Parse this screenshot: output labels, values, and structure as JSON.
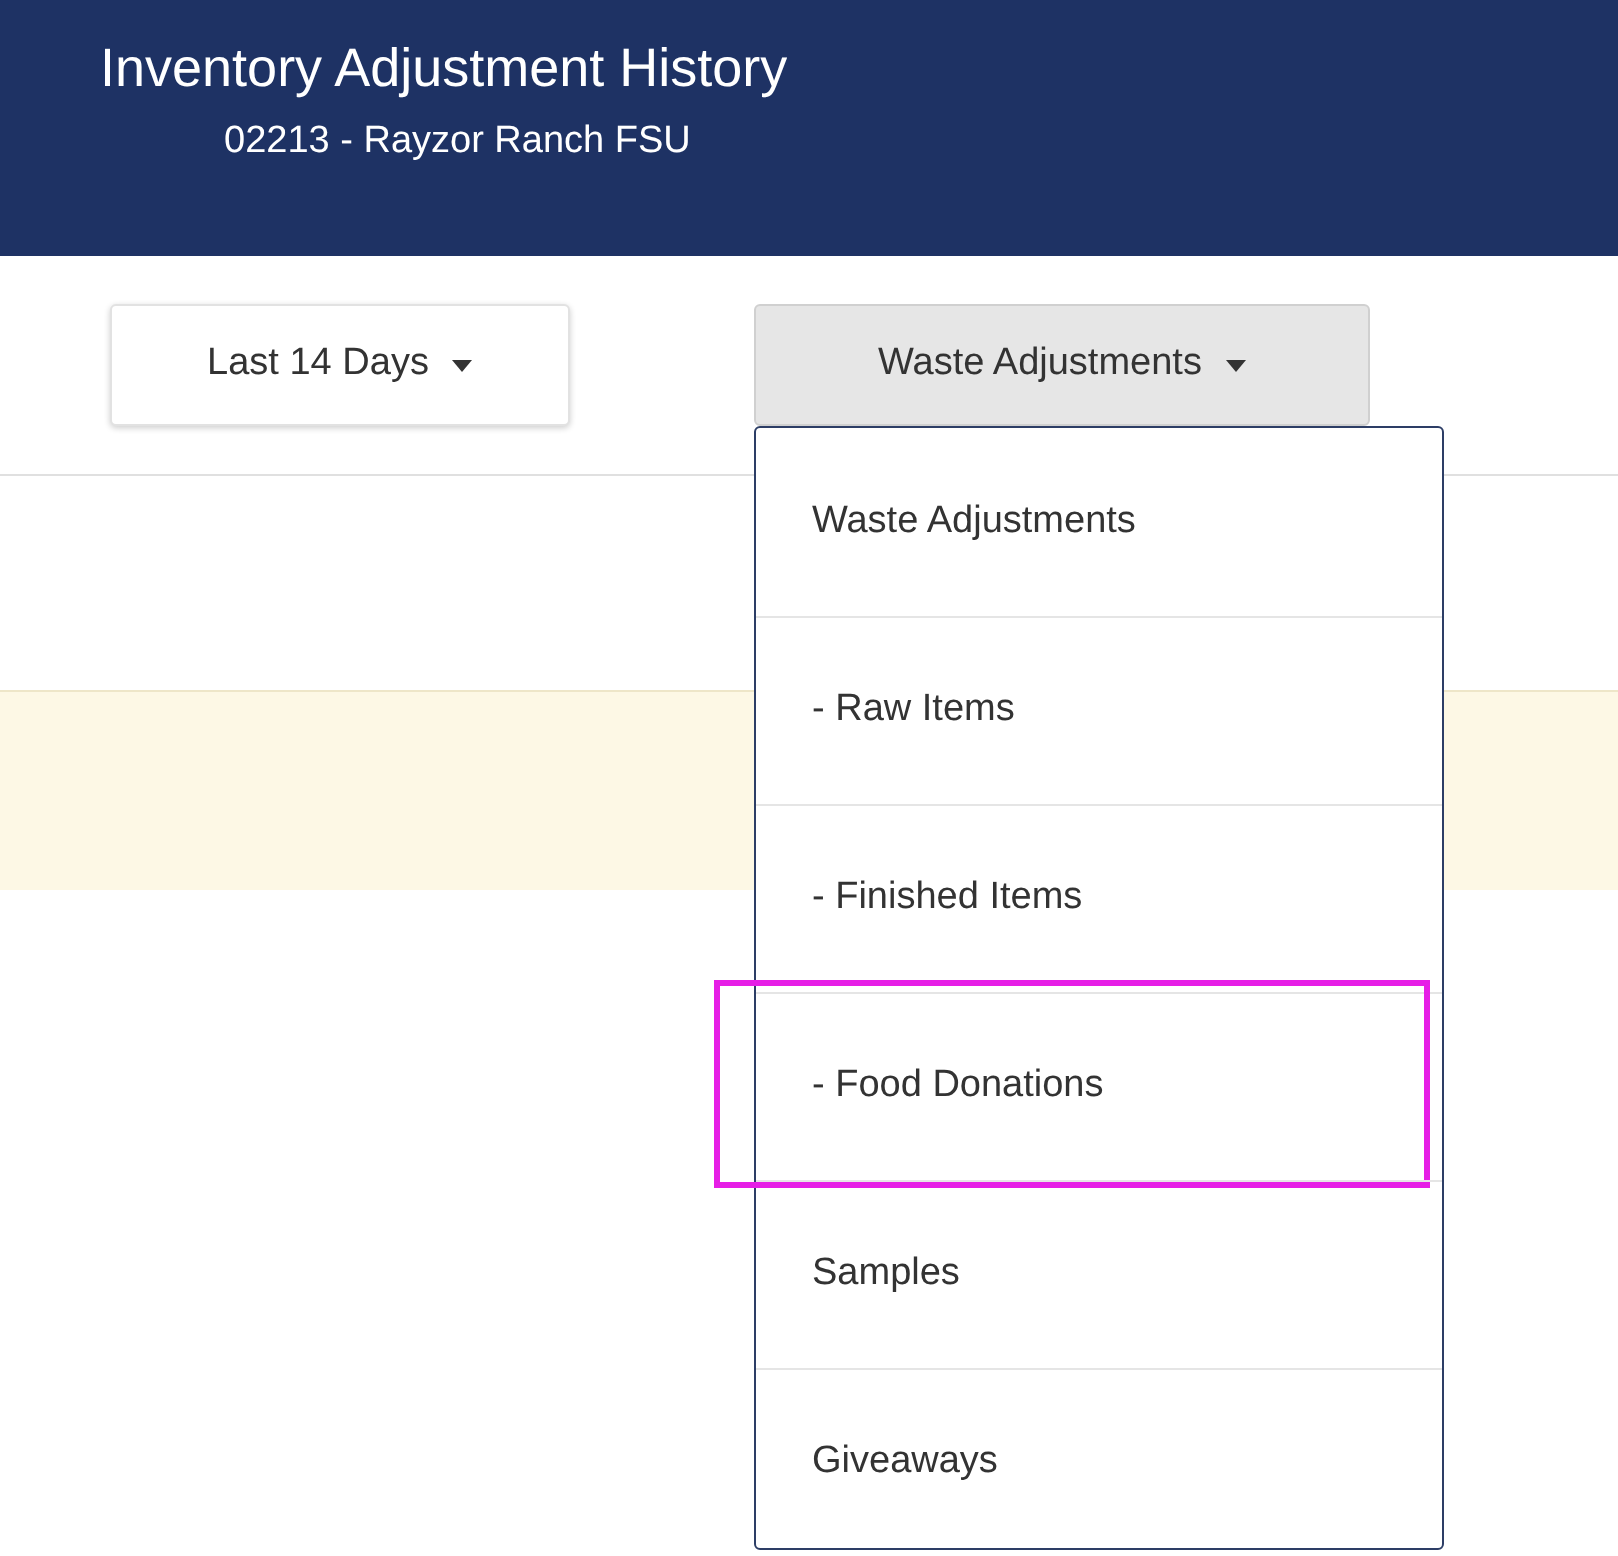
{
  "header": {
    "title": "Inventory Adjustment History",
    "subtitle": "02213 - Rayzor Ranch FSU"
  },
  "filters": [
    {
      "label": "Last 14 Days",
      "open": false
    },
    {
      "label": "Waste Adjustments",
      "open": true
    }
  ],
  "menu": {
    "items": [
      {
        "label": "Waste Adjustments",
        "highlighted": false
      },
      {
        "label": "- Raw Items",
        "highlighted": false
      },
      {
        "label": "- Finished Items",
        "highlighted": false
      },
      {
        "label": "- Food Donations",
        "highlighted": true
      },
      {
        "label": "Samples",
        "highlighted": false
      },
      {
        "label": "Giveaways",
        "highlighted": false
      }
    ]
  }
}
